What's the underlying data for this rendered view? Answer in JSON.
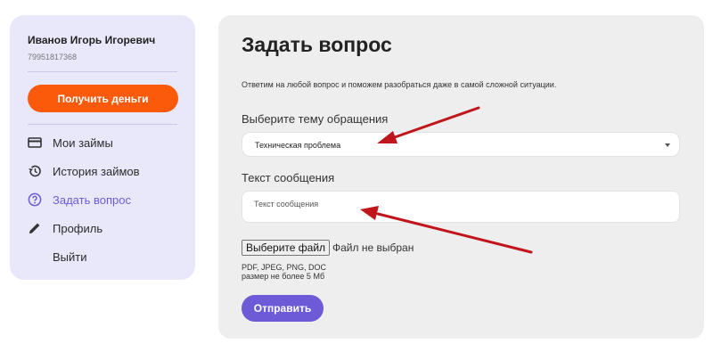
{
  "sidebar": {
    "user_name": "Иванов Игорь Игоревич",
    "user_phone": "79951817368",
    "get_money_label": "Получить деньги",
    "items": [
      {
        "label": "Мои займы",
        "icon": "credit-card-icon"
      },
      {
        "label": "История займов",
        "icon": "history-icon"
      },
      {
        "label": "Задать вопрос",
        "icon": "question-circle-icon",
        "active": true
      },
      {
        "label": "Профиль",
        "icon": "pencil-icon"
      },
      {
        "label": "Выйти",
        "icon": ""
      }
    ]
  },
  "main": {
    "title": "Задать вопрос",
    "subtitle": "Ответим на любой вопрос и поможем разобраться даже в самой сложной ситуации.",
    "topic_label": "Выберите тему обращения",
    "topic_value": "Техническая проблема",
    "message_label": "Текст сообщения",
    "message_placeholder": "Текст сообщения",
    "file_button": "Выберите файл",
    "file_status": "Файл не выбран",
    "file_types": "PDF, JPEG, PNG, DOC",
    "file_size": "размер не более 5 Мб",
    "submit_label": "Отправить"
  },
  "colors": {
    "accent_orange": "#fb5a0a",
    "accent_purple": "#6c5ad7",
    "sidebar_bg": "#e9e8fb",
    "annotation_arrow": "#c0161b"
  }
}
